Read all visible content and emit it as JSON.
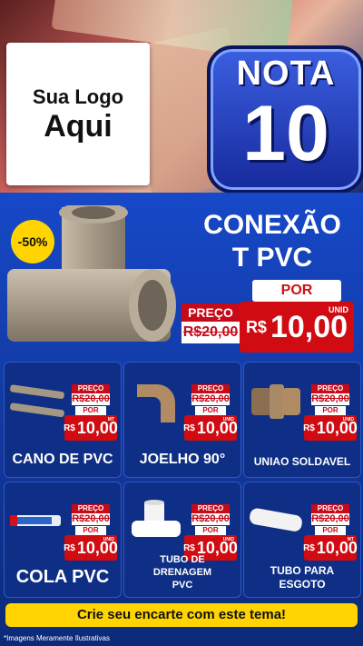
{
  "header": {
    "logo_line1": "Sua Logo",
    "logo_line2": "Aqui",
    "nota_word": "NOTA",
    "nota_number": "10"
  },
  "featured": {
    "badge": "-50%",
    "title_line1": "CONEXÃO",
    "title_line2": "T PVC",
    "por_label": "POR",
    "preco_label": "PREÇO",
    "old_price": "R$20,00",
    "currency": "R$",
    "price": "10,00",
    "unit": "UNID"
  },
  "products": [
    {
      "name": "CANO DE PVC",
      "preco_label": "PREÇO",
      "old_price": "R$20,00",
      "por_label": "POR",
      "currency": "R$",
      "price": "10,00",
      "unit": "MT"
    },
    {
      "name": "JOELHO 90°",
      "preco_label": "PREÇO",
      "old_price": "R$20,00",
      "por_label": "POR",
      "currency": "R$",
      "price": "10,00",
      "unit": "UNID"
    },
    {
      "name": "UNIAO SOLDAVEL",
      "preco_label": "PREÇO",
      "old_price": "R$20,00",
      "por_label": "POR",
      "currency": "R$",
      "price": "10,00",
      "unit": "UNID"
    },
    {
      "name": "COLA PVC",
      "preco_label": "PREÇO",
      "old_price": "R$20,00",
      "por_label": "POR",
      "currency": "R$",
      "price": "10,00",
      "unit": "UNID"
    },
    {
      "name": "TUBO DE DRENAGEM PVC",
      "preco_label": "PREÇO",
      "old_price": "R$20,00",
      "por_label": "POR",
      "currency": "R$",
      "price": "10,00",
      "unit": "UNID"
    },
    {
      "name": "TUBO PARA ESGOTO",
      "preco_label": "PREÇO",
      "old_price": "R$20,00",
      "por_label": "POR",
      "currency": "R$",
      "price": "10,00",
      "unit": "MT"
    }
  ],
  "cta": "Crie seu encarte com este tema!",
  "footnote": "*Imagens Meramente Ilustrativas",
  "colors": {
    "brand_blue": "#1748c8",
    "accent_red": "#d00b12",
    "accent_yellow": "#ffd400"
  }
}
